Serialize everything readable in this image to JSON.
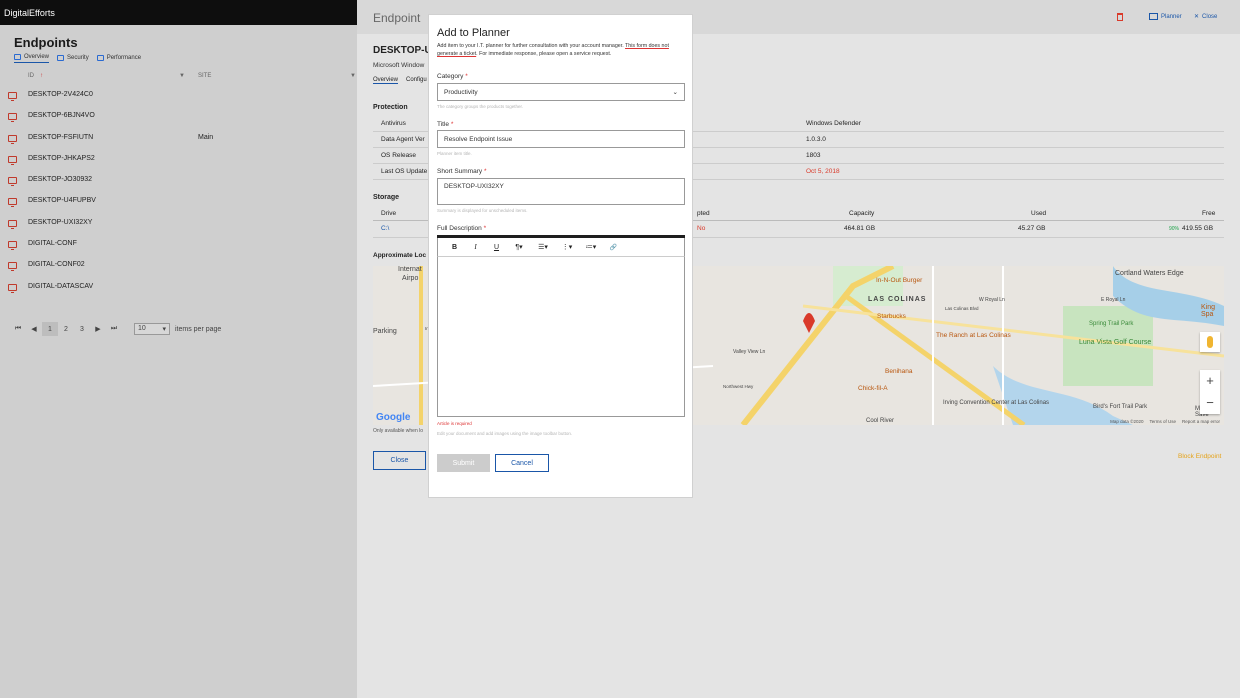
{
  "app": {
    "brand": "DigitalEfforts"
  },
  "list": {
    "title": "Endpoints",
    "tabs": [
      "Overview",
      "Security",
      "Performance"
    ],
    "columns": {
      "id": "ID",
      "site": "SITE"
    },
    "rows": [
      {
        "name": "DESKTOP-2V424C0",
        "site": ""
      },
      {
        "name": "DESKTOP-6BJN4VO",
        "site": ""
      },
      {
        "name": "DESKTOP-FSFIUTN",
        "site": "Main"
      },
      {
        "name": "DESKTOP-JHKAPS2",
        "site": ""
      },
      {
        "name": "DESKTOP-JO30932",
        "site": ""
      },
      {
        "name": "DESKTOP-U4FUPBV",
        "site": ""
      },
      {
        "name": "DESKTOP-UXI32XY",
        "site": ""
      },
      {
        "name": "DIGITAL-CONF",
        "site": ""
      },
      {
        "name": "DIGITAL-CONF02",
        "site": ""
      },
      {
        "name": "DIGITAL-DATASCAV",
        "site": ""
      }
    ],
    "pager": {
      "pages": [
        "1",
        "2",
        "3"
      ],
      "per_page": "10",
      "per_page_label": "items per page",
      "first": "⏮",
      "prev": "◀",
      "next": "▶",
      "last": "⏭"
    }
  },
  "endpoint": {
    "header": "Endpoint",
    "planner_label": "Planner",
    "close_label": "Close",
    "device_title": "DESKTOP-UX",
    "device_sub": "Microsoft Window",
    "tabs": [
      "Overview",
      "Configu"
    ],
    "protection_title": "Protection",
    "protection_rows": [
      {
        "k": "Antivirus",
        "v": "Windows Defender"
      },
      {
        "k": "Data Agent Ver",
        "v": "1.0.3.0"
      },
      {
        "k": "OS Release",
        "v": "1803"
      },
      {
        "k": "Last OS Update",
        "v": "Oct 5, 2018"
      }
    ],
    "storage_title": "Storage",
    "storage_head": {
      "drive": "Drive",
      "encrypted": "pted",
      "capacity": "Capacity",
      "used": "Used",
      "free": "Free"
    },
    "storage_row": {
      "drive": "C:\\",
      "encrypted": "No",
      "capacity": "464.81 GB",
      "used": "45.27 GB",
      "free_pct": "90%",
      "free": "419.55 GB"
    },
    "approx_title": "Approximate Loc",
    "only_note": "Only available when lo",
    "close_button": "Close",
    "block_link": "Block Endpoint",
    "accent": "#1a56a8",
    "danger": "#d93a2a"
  },
  "map": {
    "labels": [
      "Internat",
      "Airpo",
      "Parking",
      "LAS COLINAS",
      "Valley View Ln",
      "Cortland Waters Edge",
      "King Spa",
      "Spring Trail Park",
      "Luna Vista Golf Course",
      "Irving Convention Center at Las Colinas",
      "Bird's Fort Trail Park",
      "Money Save",
      "Cool River",
      "E Royal Ln",
      "W Royal Ln",
      "Las Colinas Blvd",
      "Northwest Hwy",
      "International Pkwy (Toll road)",
      "W Airport Fwy"
    ],
    "pois": [
      "In-N-Out Burger",
      "Starbucks",
      "The Ranch at Las Colinas",
      "Benihana",
      "Chick-fil-A"
    ],
    "google": "Google",
    "footer": [
      "Map data ©2020",
      "Terms of Use",
      "Report a map error"
    ],
    "zoom_in": "+",
    "zoom_out": "−"
  },
  "modal": {
    "title": "Add to Planner",
    "desc_a": "Add item to your I.T. planner for further consultation with your account manager. ",
    "desc_ul": "This form does not generate a ticket",
    "desc_b": ". For immediate response, please open a service request.",
    "category_label": "Category",
    "category_value": "Productivity",
    "category_hint": "The category groups the products together.",
    "title_label": "Title",
    "title_value": "Resolve Endpoint Issue",
    "title_hint": "Planner item title.",
    "summary_label": "Short Summary",
    "summary_value": "DESKTOP-UXI32XY",
    "summary_hint": "Summary is displayed for unscheduled items.",
    "desc_label": "Full Description",
    "required_mark": "*",
    "toolbar": {
      "bold": "B",
      "italic": "I",
      "underline": "U",
      "para": "¶▾",
      "align": "☰▾",
      "ol": "⋮▾",
      "ul": "≔▾",
      "link": "🔗"
    },
    "error": "Article is required",
    "editor_hint": "Edit your document and add images using the image toolbar button.",
    "submit": "Submit",
    "cancel": "Cancel"
  }
}
